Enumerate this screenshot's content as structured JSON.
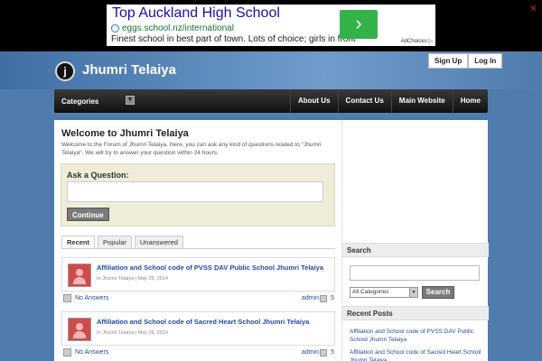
{
  "ad": {
    "title": "Top Auckland High School",
    "url": "eggs.school.nz/international",
    "description": "Finest school in best part of town. Lots of choice; girls in front",
    "cta_glyph": "›",
    "adchoices": "AdChoices ▷",
    "close_glyph": "✕"
  },
  "header": {
    "logo_letter": "j",
    "site_title": "Jhumri Telaiya",
    "signup_label": "Sign Up",
    "login_label": "Log In"
  },
  "nav": {
    "categories_label": "Categories",
    "caret_glyph": "▼",
    "links": [
      "About Us",
      "Contact Us",
      "Main Website",
      "Home"
    ]
  },
  "main": {
    "welcome_title": "Welcome to Jhumri Telaiya",
    "welcome_text": "Welcome to the Forum of Jhumri Telaiya. Here, you can ask any kind of questions related to \"Jhumri Telaiya\". We will try to answer your question within 24 hours.",
    "ask_label": "Ask a Question:",
    "ask_value": "",
    "continue_label": "Continue",
    "tabs": [
      "Recent",
      "Popular",
      "Unanswered"
    ],
    "posts": [
      {
        "title": "Affiliation and School code of PVSS DAV Public School Jhumri Telaiya",
        "meta": "In Jhumri Telaiya | May 26, 2014",
        "answers_label": "No Answers",
        "author": "admin",
        "count": "5"
      },
      {
        "title": "Affiliation and School code of Sacred Heart School Jhumri Telaiya",
        "meta": "In Jhumri Telaiya | May 26, 2014",
        "answers_label": "No Answers",
        "author": "admin",
        "count": "5"
      }
    ]
  },
  "sidebar": {
    "search_title": "Search",
    "search_value": "",
    "category_selected": "All Categories",
    "select_arrow": "▼",
    "search_button": "Search",
    "recent_title": "Recent Posts",
    "recent_posts": [
      "Affiliation and School code of PVSS DAV Public School Jhumri Telaiya",
      "Affiliation and School code of Sacred Heart School Jhumri Telaiya"
    ]
  }
}
